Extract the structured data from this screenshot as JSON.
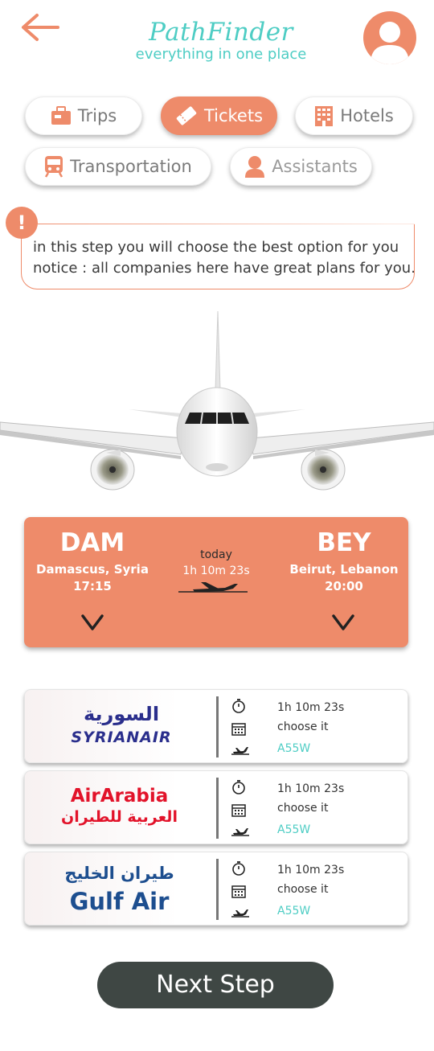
{
  "header": {
    "brand": "PathFinder",
    "tagline": "everything in one place",
    "back_icon": "arrow-left-icon",
    "avatar_icon": "user-avatar-icon"
  },
  "categories": [
    {
      "label": "Trips",
      "icon": "suitcase-icon",
      "active": false
    },
    {
      "label": "Tickets",
      "icon": "ticket-icon",
      "active": true
    },
    {
      "label": "Hotels",
      "icon": "building-icon",
      "active": false
    },
    {
      "label": "Transportation",
      "icon": "train-icon",
      "active": false
    },
    {
      "label": "Assistants",
      "icon": "person-icon",
      "active": false
    }
  ],
  "notice": {
    "badge": "!",
    "line1": "in this step you will choose the best option for you",
    "line2": "notice : all companies here have great plans for you."
  },
  "route": {
    "from": {
      "code": "DAM",
      "city": "Damascus, Syria",
      "time": "17:15"
    },
    "to": {
      "code": "BEY",
      "city": "Beirut, Lebanon",
      "time": "20:00"
    },
    "day": "today",
    "duration": "1h 10m 23s"
  },
  "airlines": [
    {
      "name_ar": "السورية",
      "name_en": "SYRIANAIR",
      "duration": "1h 10m 23s",
      "choose": "choose it",
      "code": "A55W"
    },
    {
      "name_ar": "العربية للطيران",
      "name_en": "AirArabia",
      "duration": "1h 10m 23s",
      "choose": "choose it",
      "code": "A55W"
    },
    {
      "name_ar": "طيران الخليج",
      "name_en": "Gulf Air",
      "duration": "1h 10m 23s",
      "choose": "choose it",
      "code": "A55W"
    }
  ],
  "colors": {
    "accent": "#ee8b6a",
    "brand": "#4ecdc4",
    "dark": "#3f4744"
  },
  "next_label": "Next Step"
}
